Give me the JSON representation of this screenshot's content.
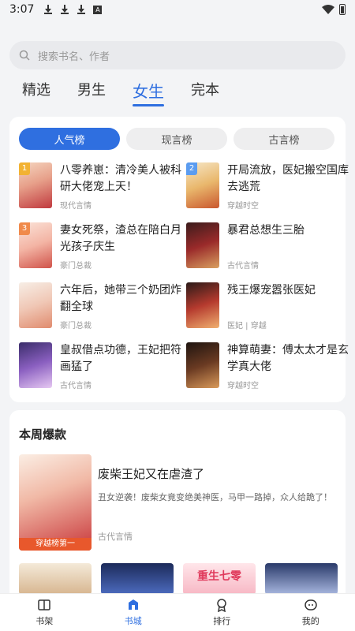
{
  "status": {
    "time": "3:07"
  },
  "search": {
    "placeholder": "搜索书名、作者"
  },
  "top_tabs": [
    {
      "label": "精选"
    },
    {
      "label": "男生"
    },
    {
      "label": "女生",
      "active": true
    },
    {
      "label": "完本"
    }
  ],
  "rank_pills": [
    {
      "label": "人气榜",
      "active": true
    },
    {
      "label": "现言榜"
    },
    {
      "label": "古言榜"
    }
  ],
  "rank_books": [
    {
      "rank": "1",
      "title": "八零养崽：清冷美人被科研大佬宠上天！",
      "tag": "现代言情",
      "badge_color": "#f2b233"
    },
    {
      "rank": "2",
      "title": "开局流放，医妃搬空国库去逃荒",
      "tag": "穿越时空",
      "badge_color": "#5b9cf0"
    },
    {
      "rank": "3",
      "title": "妻女死祭，渣总在陪白月光孩子庆生",
      "tag": "豪门总裁",
      "badge_color": "#f08a4b"
    },
    {
      "rank": "",
      "title": "暴君总想生三胎",
      "tag": "古代言情"
    },
    {
      "rank": "",
      "title": "六年后，她带三个奶团炸翻全球",
      "tag": "豪门总裁"
    },
    {
      "rank": "",
      "title": "残王爆宠嚣张医妃",
      "tag": "医妃 | 穿越"
    },
    {
      "rank": "",
      "title": "皇叔借点功德，王妃把符画猛了",
      "tag": "古代言情"
    },
    {
      "rank": "",
      "title": "神算萌妻：傅太太才是玄学真大佬",
      "tag": "穿越时空"
    }
  ],
  "weekly": {
    "section_title": "本周爆款",
    "feature": {
      "title": "废柴王妃又在虐渣了",
      "description": "丑女逆袭！废柴女竟变绝美神医，马甲一路掉，众人给跪了！",
      "tag": "古代言情",
      "cover_banner": "穿越榜第一"
    },
    "thumb_text": "重生七零"
  },
  "bottom_nav": [
    {
      "label": "书架",
      "icon": "book-open-icon"
    },
    {
      "label": "书城",
      "icon": "store-icon",
      "active": true
    },
    {
      "label": "排行",
      "icon": "medal-icon"
    },
    {
      "label": "我的",
      "icon": "face-icon"
    }
  ],
  "colors": {
    "accent": "#2f6fe0",
    "background": "#f3f4f6"
  }
}
